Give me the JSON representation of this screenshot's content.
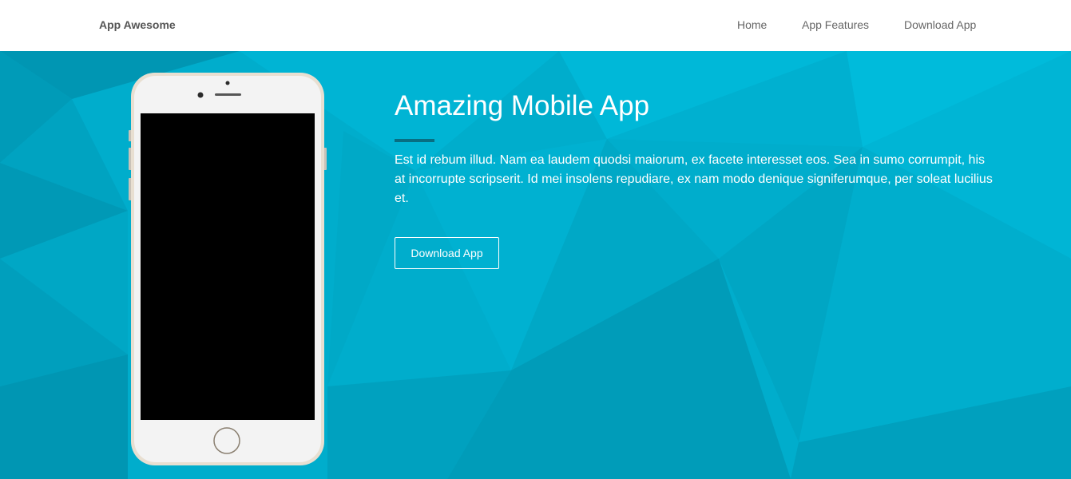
{
  "navbar": {
    "brand": "App Awesome",
    "links": [
      {
        "label": "Home"
      },
      {
        "label": "App Features"
      },
      {
        "label": "Download App"
      }
    ]
  },
  "hero": {
    "title": "Amazing Mobile App",
    "text": "Est id rebum illud. Nam ea laudem quodsi maiorum, ex facete interesset eos. Sea in sumo corrumpit, his at incorrupte scripserit. Id mei insolens repudiare, ex nam modo denique signiferumque, per soleat lucilius et.",
    "button_label": "Download App"
  },
  "colors": {
    "hero_background": "#00adcc",
    "accent_rule": "#086e82",
    "phone_body": "#f3f3f3",
    "phone_screen": "#000000"
  }
}
